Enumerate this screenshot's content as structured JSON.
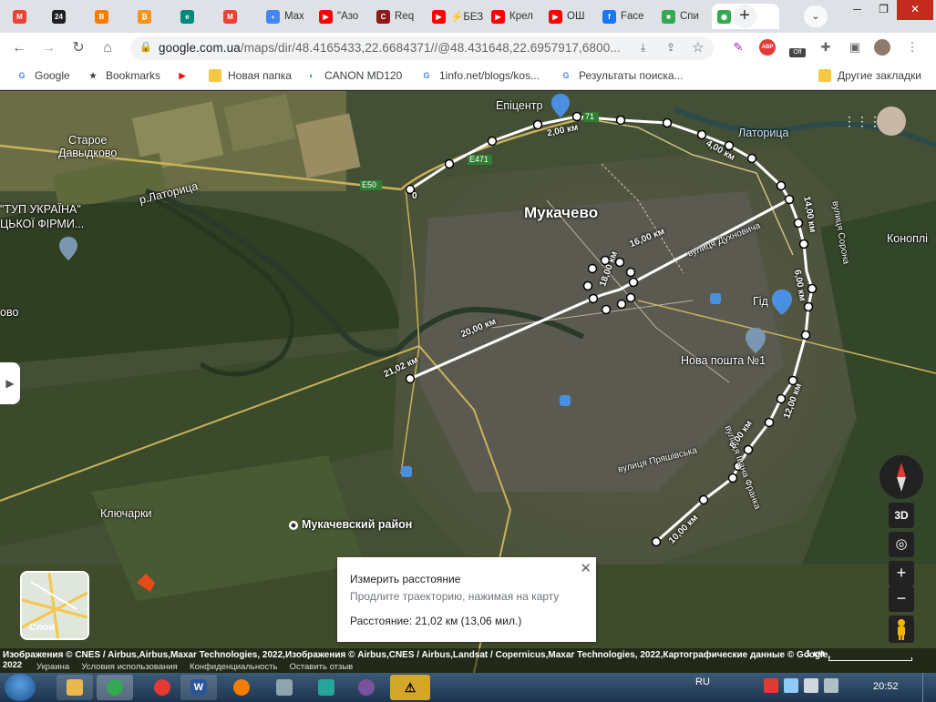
{
  "tabs": [
    {
      "title": "",
      "favicon": "M",
      "color": "#ea4335"
    },
    {
      "title": "",
      "favicon": "24",
      "color": "#202124"
    },
    {
      "title": "",
      "favicon": "B",
      "color": "#f57c00"
    },
    {
      "title": "",
      "favicon": "₿",
      "color": "#f7931a"
    },
    {
      "title": "",
      "favicon": "e",
      "color": "#00897b"
    },
    {
      "title": "",
      "favicon": "M",
      "color": "#ea4335"
    },
    {
      "title": "Max",
      "favicon": "◗",
      "color": "#4285f4"
    },
    {
      "title": "\"Азо",
      "favicon": "▶",
      "color": "#ff0000"
    },
    {
      "title": "Req",
      "favicon": "C",
      "color": "#8b1a1a"
    },
    {
      "title": "⚡БЕЗ",
      "favicon": "▶",
      "color": "#ff0000"
    },
    {
      "title": "Крел",
      "favicon": "▶",
      "color": "#ff0000"
    },
    {
      "title": "ОШ",
      "favicon": "▶",
      "color": "#ff0000"
    },
    {
      "title": "Face",
      "favicon": "f",
      "color": "#1877f2"
    },
    {
      "title": "Спи",
      "favicon": "■",
      "color": "#34a853"
    },
    {
      "title": "",
      "favicon": "◉",
      "color": "#34a853",
      "active": true
    }
  ],
  "window": {
    "minimize": "─",
    "restore": "❐",
    "close": "✕",
    "new_tab": "+",
    "tab_menu": "⌄"
  },
  "address_bar": {
    "url_host": "google.com.ua",
    "url_rest": "/maps/dir/48.4165433,22.6684371//@48.431648,22.6957917,6800..."
  },
  "toolbar": {
    "back": "←",
    "forward": "→",
    "reload": "↻",
    "home": "⌂",
    "abp_label": "ABP",
    "off_label": "Off"
  },
  "bookmarks": [
    {
      "label": "Google",
      "icon": "G",
      "color": "#4285f4"
    },
    {
      "label": "Bookmarks",
      "icon": "★",
      "color": "#3c4043"
    },
    {
      "label": "",
      "icon": "▶",
      "color": "#ff0000"
    },
    {
      "label": "Новая папка",
      "icon": "",
      "color": "#f6c744"
    },
    {
      "label": "CANON MD120",
      "icon": "◐",
      "color": "#1e88e5"
    },
    {
      "label": "1info.net/blogs/kos...",
      "icon": "G",
      "color": "#4285f4"
    },
    {
      "label": "Результаты поиска...",
      "icon": "G",
      "color": "#4285f4"
    }
  ],
  "other_bookmarks": "Другие закладки",
  "map": {
    "city": "Мукачево",
    "labels": {
      "starоe": "Старое",
      "davydkovo": "Давыдково",
      "latoritsa_river": "р.Латорица",
      "epicenter": "Епіцентр",
      "tup_ukraina": "\"ТУП УКРАЇНА\"",
      "tskoi_firmy": "ЦЬКОЇ ФІРМИ...",
      "vo": "ово",
      "latoritsa": "Латорица",
      "sorona": "вулиця Сорона",
      "konopl": "Коноплі",
      "dukhnovycha": "вулиця Духновича",
      "gid": "Гід",
      "nova_poshta": "Нова пошта №1",
      "pryashivska": "вулиця Пряшівська",
      "franka": "вулиця Івана Франка",
      "klyucharky": "Ключарки",
      "district": "Мукачевский район",
      "e50": "E50",
      "e471": "E471",
      "r71": "71"
    },
    "distance_labels": [
      "0",
      "2,00 км",
      "4,00 км",
      "6,00 км",
      "8,00 км",
      "10,00 км",
      "12,00 км",
      "14,00 км",
      "16,00 км",
      "18,00 км",
      "20,00 км",
      "21,02 км"
    ]
  },
  "layers": {
    "label": "Слои"
  },
  "measure_panel": {
    "title": "Измерить расстояние",
    "hint": "Продлите траекторию, нажимая на карту",
    "distance": "Расстояние: 21,02 км (13,06 мил.)",
    "close": "✕"
  },
  "controls": {
    "view_3d": "3D",
    "zoom_in": "+",
    "zoom_out": "−",
    "location": "◎",
    "apps": "⋮⋮⋮"
  },
  "attribution": {
    "line1": "Изображения © CNES / Airbus,Airbus,Maxar Technologies, 2022,Изображения © Airbus,CNES / Airbus,Landsat / Copernicus,Maxar Technologies, 2022,Картографические данные © Google,",
    "year": "2022",
    "links": [
      "Украина",
      "Условия использования",
      "Конфиденциальность",
      "Оставить отзыв"
    ],
    "scale": "1 км"
  },
  "taskbar": {
    "language": "RU",
    "time": "20:52"
  }
}
